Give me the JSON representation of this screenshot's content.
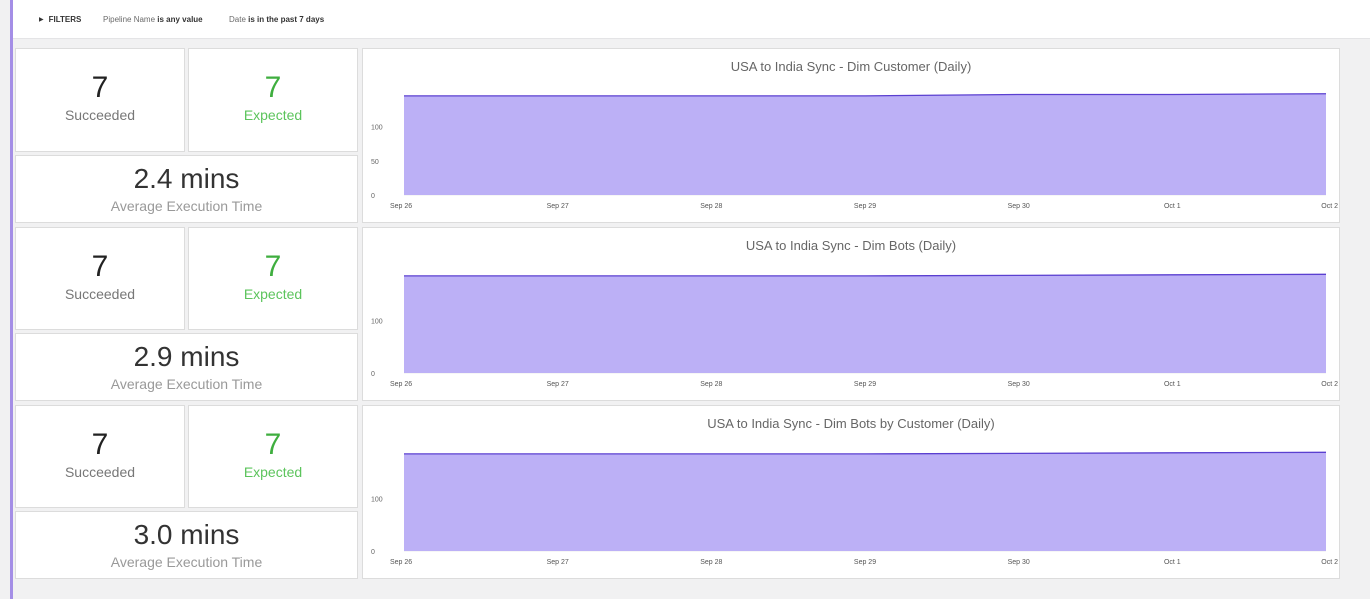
{
  "filters": {
    "toggle_label": "FILTERS",
    "items": [
      {
        "field": "Pipeline Name",
        "condition": "is any value"
      },
      {
        "field": "Date",
        "condition": "is in the past 7 days"
      }
    ]
  },
  "colors": {
    "area_fill": "#bcb0f6",
    "area_line": "#5a3fd0",
    "green": "#3fae3f"
  },
  "rows": [
    {
      "succeeded": {
        "value": "7",
        "label": "Succeeded"
      },
      "expected": {
        "value": "7",
        "label": "Expected"
      },
      "exec_time": {
        "value": "2.4 mins",
        "label": "Average Execution Time"
      },
      "chart_data": {
        "type": "area",
        "title": "USA to India Sync - Dim Customer (Daily)",
        "x": [
          "Sep 26",
          "Sep 27",
          "Sep 28",
          "Sep 29",
          "Sep 30",
          "Oct 1",
          "Oct 2"
        ],
        "values": [
          145,
          145,
          145,
          145,
          147,
          147,
          148
        ],
        "yticks": [
          0,
          50,
          100
        ],
        "ylim": [
          0,
          155
        ],
        "grid": true
      }
    },
    {
      "succeeded": {
        "value": "7",
        "label": "Succeeded"
      },
      "expected": {
        "value": "7",
        "label": "Expected"
      },
      "exec_time": {
        "value": "2.9 mins",
        "label": "Average Execution Time"
      },
      "chart_data": {
        "type": "area",
        "title": "USA to India Sync - Dim Bots (Daily)",
        "x": [
          "Sep 26",
          "Sep 27",
          "Sep 28",
          "Sep 29",
          "Sep 30",
          "Oct 1",
          "Oct 2"
        ],
        "values": [
          185,
          185,
          185,
          185,
          186,
          187,
          188
        ],
        "yticks": [
          0,
          100
        ],
        "ylim": [
          0,
          200
        ],
        "grid": true
      }
    },
    {
      "succeeded": {
        "value": "7",
        "label": "Succeeded"
      },
      "expected": {
        "value": "7",
        "label": "Expected"
      },
      "exec_time": {
        "value": "3.0 mins",
        "label": "Average Execution Time"
      },
      "chart_data": {
        "type": "area",
        "title": "USA to India Sync - Dim Bots by Customer (Daily)",
        "x": [
          "Sep 26",
          "Sep 27",
          "Sep 28",
          "Sep 29",
          "Sep 30",
          "Oct 1",
          "Oct 2"
        ],
        "values": [
          185,
          185,
          185,
          185,
          186,
          187,
          188
        ],
        "yticks": [
          0,
          100
        ],
        "ylim": [
          0,
          200
        ],
        "grid": true
      }
    }
  ]
}
